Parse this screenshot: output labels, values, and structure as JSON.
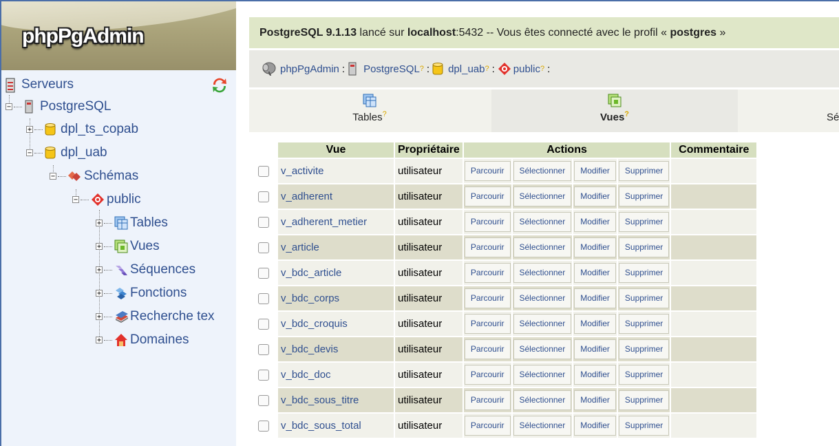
{
  "app": {
    "logo": "phpPgAdmin"
  },
  "tree": {
    "servers": "Serveurs",
    "server": "PostgreSQL",
    "databases": [
      "dpl_ts_copab",
      "dpl_uab"
    ],
    "schemas": "Schémas",
    "schema": "public",
    "children": [
      "Tables",
      "Vues",
      "Séquences",
      "Fonctions",
      "Recherche tex",
      "Domaines"
    ]
  },
  "topbar": {
    "product": "PostgreSQL 9.1.13",
    "on": " lancé sur ",
    "host": "localhost",
    "port_text": ":5432 -- Vous êtes connecté avec le profil « ",
    "user": "postgres",
    "end": " »"
  },
  "breadcrumb": {
    "items": [
      "phpPgAdmin",
      "PostgreSQL",
      "dpl_uab",
      "public"
    ],
    "help": "?",
    "sep": ":"
  },
  "tabs": [
    {
      "label": "Tables",
      "active": false
    },
    {
      "label": "Vues",
      "active": true
    },
    {
      "label": "Sé",
      "active": false
    }
  ],
  "table": {
    "headers": {
      "vue": "Vue",
      "owner": "Propriétaire",
      "actions": "Actions",
      "comment": "Commentaire"
    },
    "actions": [
      "Parcourir",
      "Sélectionner",
      "Modifier",
      "Supprimer"
    ],
    "rows": [
      {
        "name": "v_activite",
        "owner": "utilisateur"
      },
      {
        "name": "v_adherent",
        "owner": "utilisateur"
      },
      {
        "name": "v_adherent_metier",
        "owner": "utilisateur"
      },
      {
        "name": "v_article",
        "owner": "utilisateur"
      },
      {
        "name": "v_bdc_article",
        "owner": "utilisateur"
      },
      {
        "name": "v_bdc_corps",
        "owner": "utilisateur"
      },
      {
        "name": "v_bdc_croquis",
        "owner": "utilisateur"
      },
      {
        "name": "v_bdc_devis",
        "owner": "utilisateur"
      },
      {
        "name": "v_bdc_doc",
        "owner": "utilisateur"
      },
      {
        "name": "v_bdc_sous_titre",
        "owner": "utilisateur"
      },
      {
        "name": "v_bdc_sous_total",
        "owner": "utilisateur"
      }
    ]
  },
  "colors": {
    "link": "#2f4f8f",
    "header_bg": "#d6dfbf",
    "row_alt": "#deddcb",
    "help": "#d9a800"
  }
}
